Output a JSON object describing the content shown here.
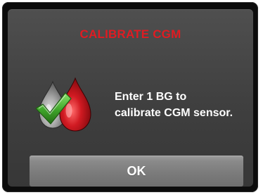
{
  "dialog": {
    "title": "CALIBRATE CGM",
    "message_line1": "Enter 1 BG to",
    "message_line2": "calibrate CGM sensor.",
    "icon": "blood-drop-with-checkmark-icon",
    "ok_label": "OK"
  },
  "colors": {
    "title": "#e01b22",
    "panel": "#454545",
    "button": "#858585",
    "blood_drop": "#b5121b",
    "checkmark": "#4fb233"
  }
}
